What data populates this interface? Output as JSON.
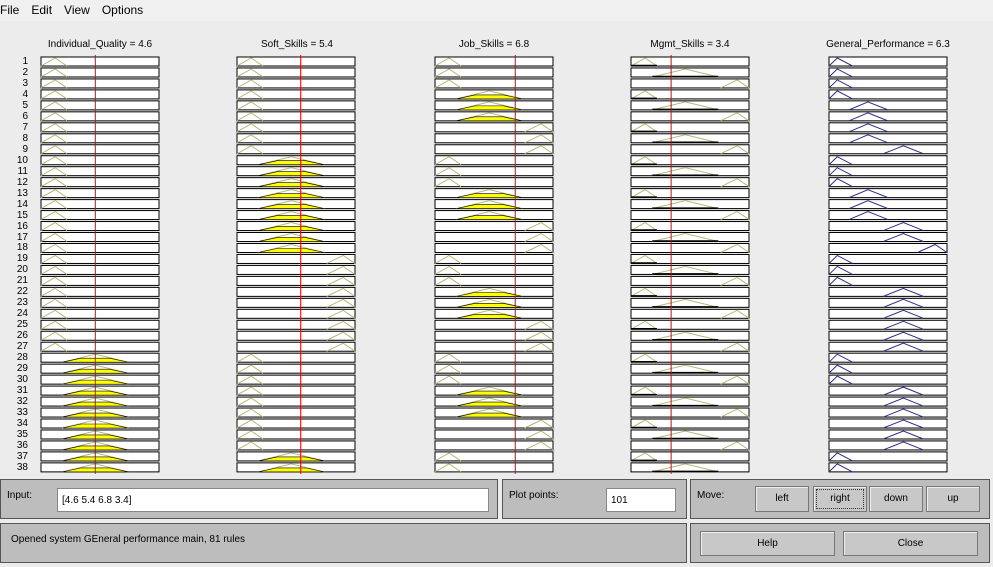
{
  "menu": [
    "File",
    "Edit",
    "View",
    "Options"
  ],
  "variables": [
    {
      "name": "Individual_Quality",
      "title": "Individual_Quality = 4.6",
      "value": 4.6,
      "range": [
        0,
        10
      ]
    },
    {
      "name": "Soft_Skills",
      "title": "Soft_Skills = 5.4",
      "value": 5.4,
      "range": [
        0,
        10
      ]
    },
    {
      "name": "Job_Skills",
      "title": "Job_Skills = 6.8",
      "value": 6.8,
      "range": [
        0,
        10
      ]
    },
    {
      "name": "Mgmt_Skills",
      "title": "Mgmt_Skills = 3.4",
      "value": 3.4,
      "range": [
        0,
        10
      ]
    },
    {
      "name": "General_Performance",
      "title": "General_Performance = 6.3",
      "value": 6.3,
      "range": [
        0,
        10
      ]
    }
  ],
  "rules_visible": 38,
  "output_mf": [
    0,
    0,
    0,
    0,
    1,
    1,
    1,
    1,
    2,
    0,
    0,
    0,
    1,
    1,
    1,
    2,
    2,
    3,
    0,
    0,
    0,
    2,
    2,
    2,
    2,
    2,
    2,
    0,
    0,
    0,
    2,
    2,
    2,
    2,
    2,
    2,
    0,
    0
  ],
  "colors": {
    "input_line": "#b8b878",
    "fired": "#ffff00",
    "output": "#30308a",
    "cursor": "#e00000"
  },
  "input": {
    "label": "Input:",
    "value": "[4.6 5.4 6.8 3.4]"
  },
  "plot_points": {
    "label": "Plot points:",
    "value": "101"
  },
  "move": {
    "label": "Move:",
    "left": "left",
    "right": "right",
    "down": "down",
    "up": "up"
  },
  "status": "Opened system GEneral performance main, 81 rules",
  "help": "Help",
  "close": "Close"
}
